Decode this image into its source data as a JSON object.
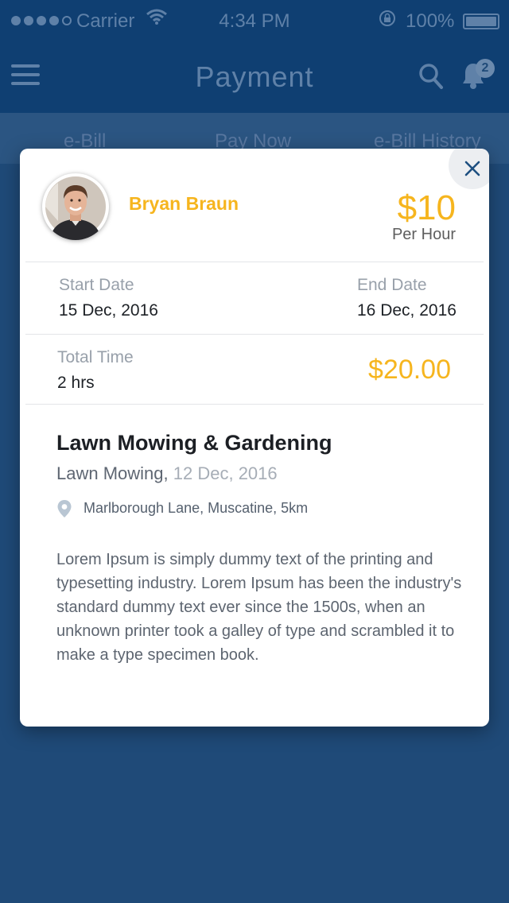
{
  "status_bar": {
    "carrier": "Carrier",
    "time": "4:34 PM",
    "battery": "100%"
  },
  "nav": {
    "title": "Payment",
    "notification_count": "2"
  },
  "tabs": [
    {
      "label": "e-Bill"
    },
    {
      "label": "Pay Now"
    },
    {
      "label": "e-Bill History"
    }
  ],
  "modal": {
    "user": {
      "name": "Bryan Braun"
    },
    "rate": {
      "amount": "$10",
      "unit": "Per Hour"
    },
    "start": {
      "label": "Start Date",
      "value": "15 Dec, 2016"
    },
    "end": {
      "label": "End Date",
      "value": "16 Dec, 2016"
    },
    "total_time": {
      "label": "Total Time",
      "value": "2 hrs"
    },
    "total_amount": "$20.00",
    "job": {
      "title": "Lawn Mowing & Gardening",
      "type": "Lawn Mowing,",
      "date": "12 Dec, 2016",
      "location": "Marlborough Lane, Muscatine, 5km",
      "description": "Lorem Ipsum is simply dummy text of the printing and typesetting industry. Lorem Ipsum has been the industry's standard dummy text ever since the 1500s, when an unknown printer took a galley of type and scrambled it to make a type specimen book."
    }
  },
  "icons": {
    "menu": "menu-icon",
    "search": "search-icon",
    "bell": "bell-icon",
    "close": "close-icon",
    "location": "location-pin-icon"
  },
  "colors": {
    "header_bg": "#0f3f72",
    "overlay_bg": "#1f4a78",
    "accent": "#f6b51e",
    "card_bg": "#ffffff"
  }
}
